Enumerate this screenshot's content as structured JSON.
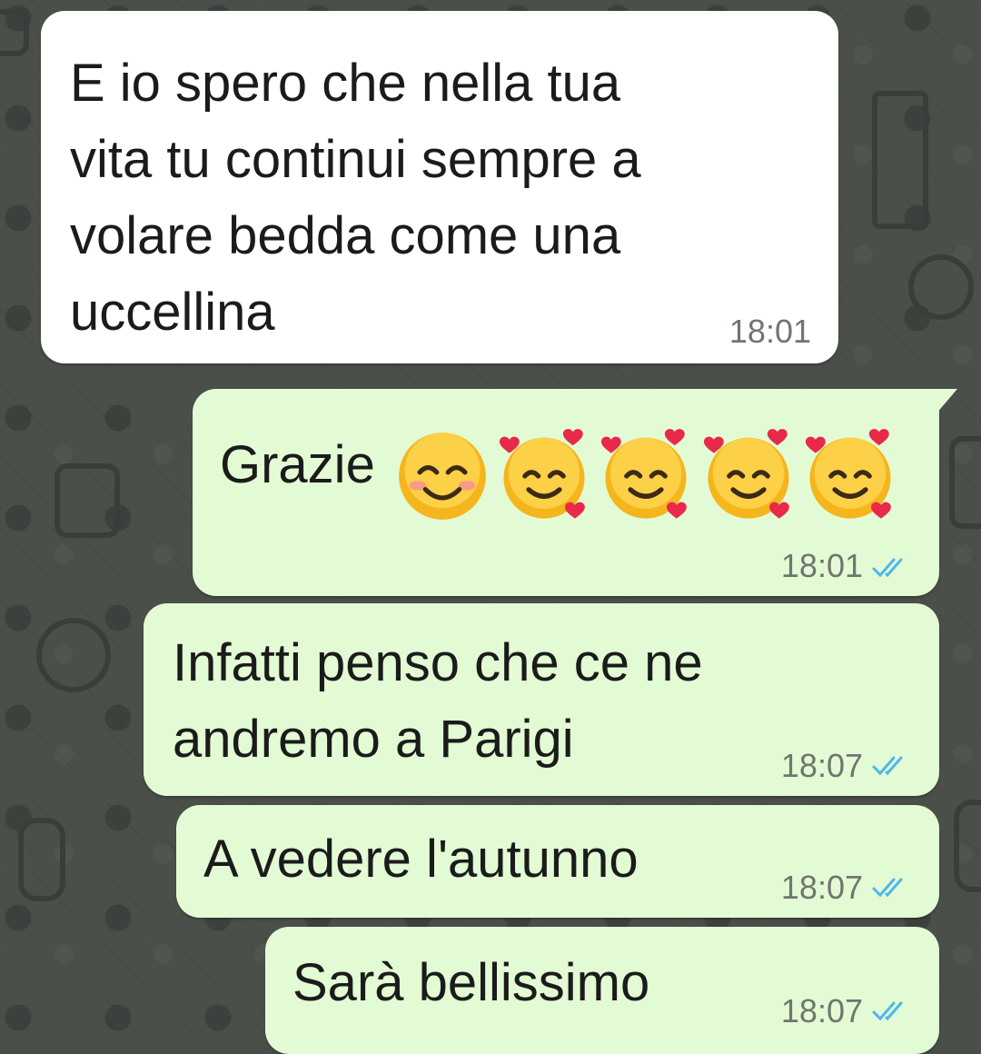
{
  "messages": [
    {
      "direction": "incoming",
      "lines": [
        "E io spero che nella tua",
        "vita tu continui sempre a",
        "volare bedda come una",
        "uccellina"
      ],
      "time": "18:01"
    },
    {
      "direction": "outgoing",
      "text": "Grazie",
      "emojis": [
        "smiling-face-with-smiling-eyes",
        "smiling-face-with-hearts",
        "smiling-face-with-hearts",
        "smiling-face-with-hearts",
        "smiling-face-with-hearts"
      ],
      "time": "18:01",
      "status": "read"
    },
    {
      "direction": "outgoing",
      "lines": [
        "Infatti penso che ce ne",
        "andremo a Parigi"
      ],
      "time": "18:07",
      "status": "read"
    },
    {
      "direction": "outgoing",
      "text": "A vedere l'autunno",
      "time": "18:07",
      "status": "read"
    },
    {
      "direction": "outgoing",
      "text": "Sarà bellissimo",
      "time": "18:07",
      "status": "read"
    }
  ],
  "colors": {
    "incoming_bubble": "#ffffff",
    "outgoing_bubble": "#e3fbd4",
    "read_ticks": "#4fb6ec",
    "wallpaper": "#4b4f4a"
  }
}
